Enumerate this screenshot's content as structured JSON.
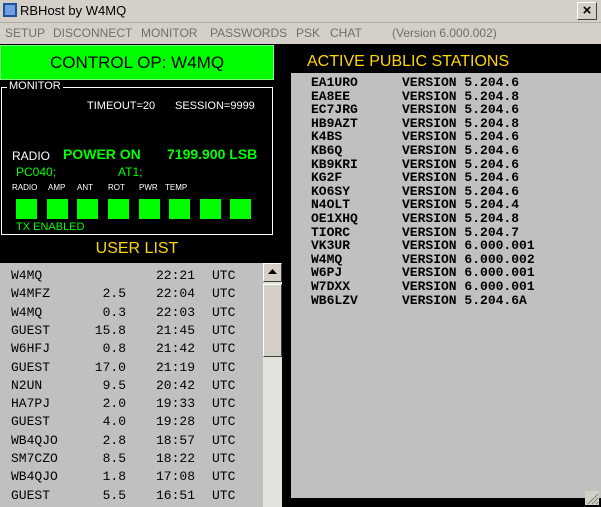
{
  "window": {
    "title": "RBHost by W4MQ",
    "close_glyph": "×"
  },
  "menu": {
    "items": [
      "SETUP",
      "DISCONNECT",
      "MONITOR",
      "PASSWORDS",
      "PSK",
      "CHAT"
    ],
    "version": "(Version 6.000.002)"
  },
  "control": {
    "label": "CONTROL OP: W4MQ"
  },
  "monitor": {
    "legend": "MONITOR",
    "timeout": "TIMEOUT=20",
    "session": "SESSION=9999",
    "radio_label": "RADIO",
    "power_status": "POWER ON",
    "frequency": "7199.900 LSB",
    "pc_cmd": "PC040;",
    "at_cmd": "AT1;",
    "indicators": [
      "RADIO",
      "AMP",
      "ANT",
      "ROT",
      "PWR",
      "TEMP"
    ],
    "tx_status": "TX ENABLED"
  },
  "user_list": {
    "title": "USER LIST",
    "rows": [
      {
        "call": "W4MQ",
        "dist": "",
        "time": "22:21",
        "tz": "UTC"
      },
      {
        "call": "W4MFZ",
        "dist": "2.5",
        "time": "22:04",
        "tz": "UTC"
      },
      {
        "call": "W4MQ",
        "dist": "0.3",
        "time": "22:03",
        "tz": "UTC"
      },
      {
        "call": "GUEST",
        "dist": "15.8",
        "time": "21:45",
        "tz": "UTC"
      },
      {
        "call": "W6HFJ",
        "dist": "0.8",
        "time": "21:42",
        "tz": "UTC"
      },
      {
        "call": "GUEST",
        "dist": "17.0",
        "time": "21:19",
        "tz": "UTC"
      },
      {
        "call": "N2UN",
        "dist": "9.5",
        "time": "20:42",
        "tz": "UTC"
      },
      {
        "call": "HA7PJ",
        "dist": "2.0",
        "time": "19:33",
        "tz": "UTC"
      },
      {
        "call": "GUEST",
        "dist": "4.0",
        "time": "19:28",
        "tz": "UTC"
      },
      {
        "call": "WB4QJO",
        "dist": "2.8",
        "time": "18:57",
        "tz": "UTC"
      },
      {
        "call": "SM7CZO",
        "dist": "8.5",
        "time": "18:22",
        "tz": "UTC"
      },
      {
        "call": "WB4QJO",
        "dist": "1.8",
        "time": "17:08",
        "tz": "UTC"
      },
      {
        "call": "GUEST",
        "dist": "5.5",
        "time": "16:51",
        "tz": "UTC"
      }
    ]
  },
  "stations": {
    "title": "ACTIVE PUBLIC STATIONS",
    "rows": [
      {
        "call": "EA1URO",
        "version": "VERSION 5.204.6"
      },
      {
        "call": "EA8EE",
        "version": "VERSION 5.204.8"
      },
      {
        "call": "EC7JRG",
        "version": "VERSION 5.204.6"
      },
      {
        "call": "HB9AZT",
        "version": "VERSION 5.204.8"
      },
      {
        "call": "K4BS",
        "version": "VERSION 5.204.6"
      },
      {
        "call": "KB6Q",
        "version": "VERSION 5.204.6"
      },
      {
        "call": "KB9KRI",
        "version": "VERSION 5.204.6"
      },
      {
        "call": "KG2F",
        "version": "VERSION 5.204.6"
      },
      {
        "call": "KO6SY",
        "version": "VERSION 5.204.6"
      },
      {
        "call": "N4OLT",
        "version": "VERSION 5.204.4"
      },
      {
        "call": "OE1XHQ",
        "version": "VERSION 5.204.8"
      },
      {
        "call": "TIORC",
        "version": "VERSION 5.204.7"
      },
      {
        "call": "VK3UR",
        "version": "VERSION 6.000.001"
      },
      {
        "call": "W4MQ",
        "version": "VERSION 6.000.002"
      },
      {
        "call": "W6PJ",
        "version": "VERSION 6.000.001"
      },
      {
        "call": "W7DXX",
        "version": "VERSION 6.000.001"
      },
      {
        "call": "WB6LZV",
        "version": "VERSION 5.204.6A"
      }
    ]
  },
  "colors": {
    "accent_green": "#00ff00",
    "title_yellow": "#ffd700",
    "background": "#000000",
    "list_gray": "#c0c0c0"
  }
}
